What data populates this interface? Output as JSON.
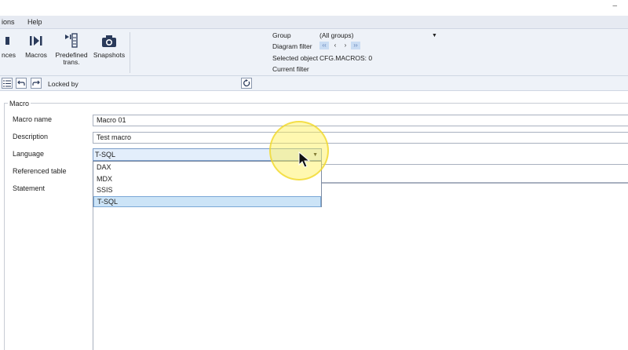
{
  "window": {
    "minimize_glyph": "–"
  },
  "menu": {
    "items": [
      "ions",
      "Help"
    ]
  },
  "ribbon": {
    "buttons": [
      {
        "label": "nces",
        "icon": "stop-icon"
      },
      {
        "label": "Macros",
        "icon": "play-step-icon"
      },
      {
        "label": "Predefined\ntrans.",
        "icon": "predefined-transform-icon"
      },
      {
        "label": "Snapshots",
        "icon": "camera-icon"
      }
    ],
    "group_label": "Group",
    "group_value": "(All groups)",
    "diagram_filter_label": "Diagram filter",
    "nav": [
      "‹‹",
      "‹",
      "›",
      "››"
    ],
    "selected_object_label": "Selected object",
    "selected_object_value": "CFG.MACROS: 0",
    "current_filter_label": "Current filter"
  },
  "toolbar": {
    "locked_by_label": "Locked by"
  },
  "form": {
    "group_title": "Macro",
    "macro_name_label": "Macro name",
    "macro_name_value": "Macro 01",
    "description_label": "Description",
    "description_value": "Test macro",
    "language_label": "Language",
    "language_value": "T-SQL",
    "referenced_table_label": "Referenced table",
    "statement_label": "Statement"
  },
  "language_dropdown": {
    "options": [
      "DAX",
      "MDX",
      "SSIS",
      "T-SQL"
    ],
    "selected": "T-SQL"
  },
  "colors": {
    "selection": "#cce4f7",
    "highlight": "#fff050"
  }
}
